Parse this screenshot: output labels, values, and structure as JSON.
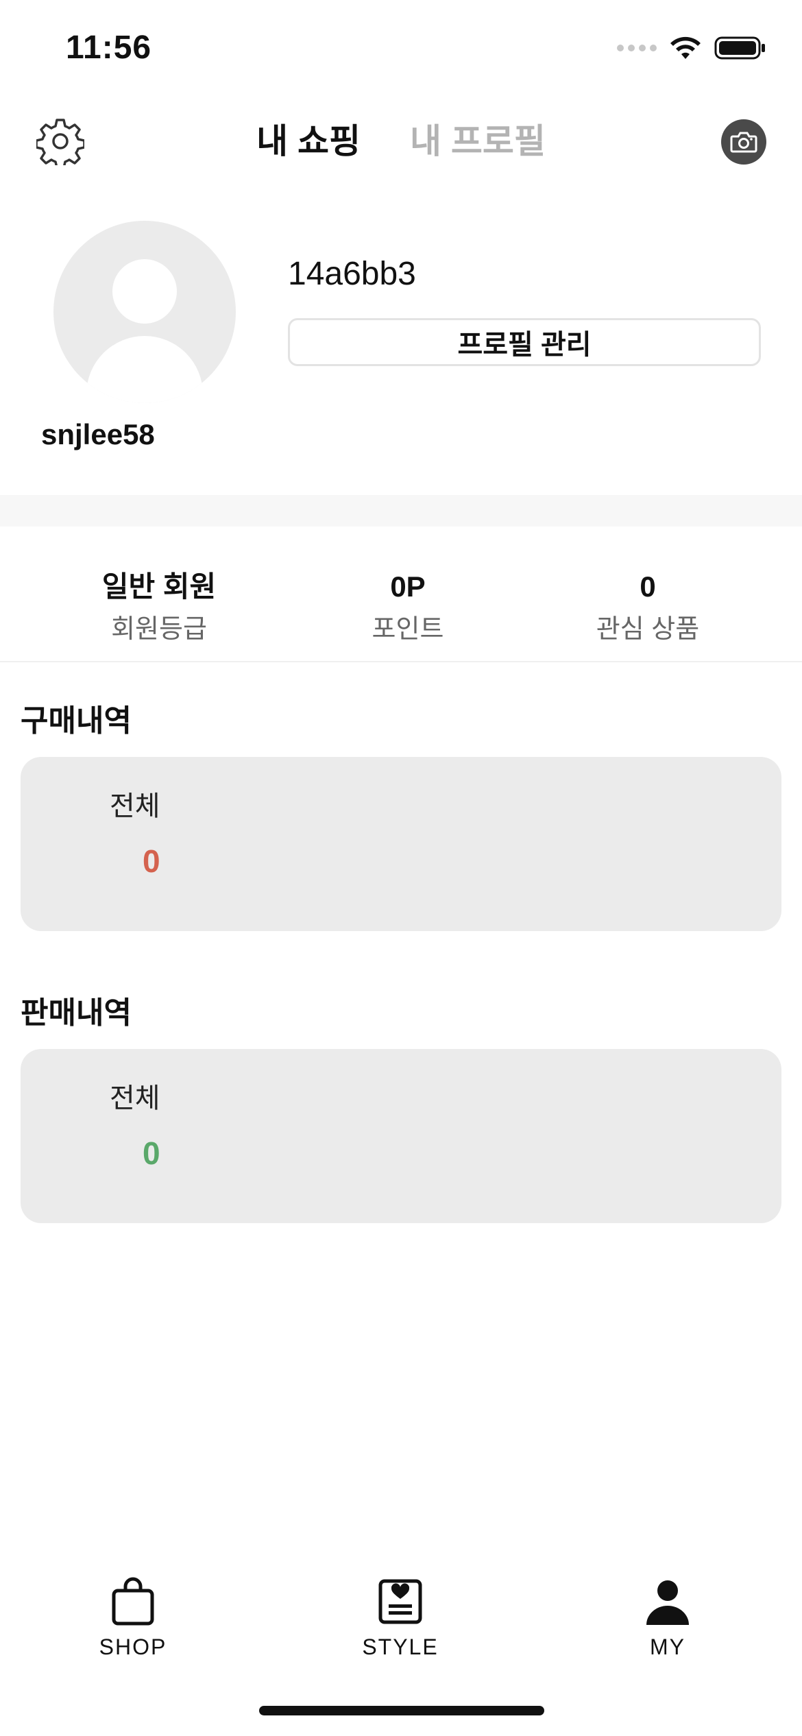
{
  "status_bar": {
    "time": "11:56",
    "icons": [
      "signal-icon",
      "wifi-icon",
      "battery-icon"
    ]
  },
  "header": {
    "tabs": [
      {
        "label": "내 쇼핑",
        "active": true
      },
      {
        "label": "내 프로필",
        "active": false
      }
    ],
    "left_icon": "gear-icon",
    "right_icon": "camera-icon"
  },
  "profile": {
    "username": "snjlee58",
    "user_id": "14a6bb3",
    "manage_label": "프로필 관리"
  },
  "stats": [
    {
      "value": "일반 회원",
      "label": "회원등급"
    },
    {
      "value": "0P",
      "label": "포인트"
    },
    {
      "value": "0",
      "label": "관심 상품"
    }
  ],
  "purchase_history": {
    "title": "구매내역",
    "label": "전체",
    "count": "0",
    "count_color": "#d4624e"
  },
  "sales_history": {
    "title": "판매내역",
    "label": "전체",
    "count": "0",
    "count_color": "#5aa86a"
  },
  "bottom_nav": [
    {
      "label": "SHOP",
      "icon": "shopping-bag-icon"
    },
    {
      "label": "STYLE",
      "icon": "style-card-icon"
    },
    {
      "label": "MY",
      "icon": "person-icon"
    }
  ]
}
